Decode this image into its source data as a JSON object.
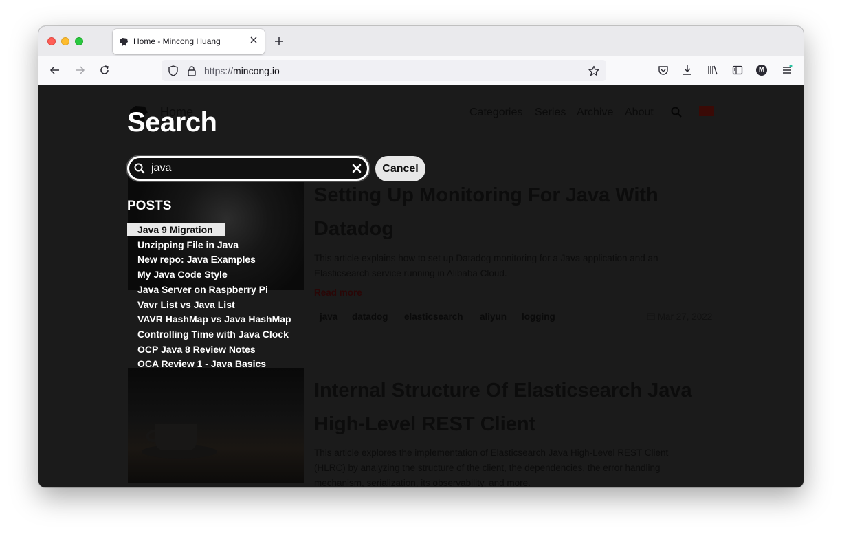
{
  "browser": {
    "tab": {
      "title": "Home - Mincong Huang"
    },
    "url": {
      "scheme": "https://",
      "host": "mincong.io"
    },
    "account_initial": "M"
  },
  "site": {
    "title": "Home",
    "nav": [
      "Categories",
      "Series",
      "Archive",
      "About"
    ]
  },
  "search": {
    "heading": "Search",
    "query": "java",
    "cancel_label": "Cancel",
    "section_heading": "POSTS",
    "selected_index": 0,
    "results": [
      "Java 9 Migration",
      "Unzipping File in Java",
      "New repo: Java Examples",
      "My Java Code Style",
      "Java Server on Raspberry Pi",
      "Vavr List vs Java List",
      "VAVR HashMap vs Java HashMap",
      "Controlling Time with Java Clock",
      "OCP Java 8 Review Notes",
      "OCA Review 1 - Java Basics"
    ]
  },
  "posts": [
    {
      "title_line1": "Setting Up Monitoring For Java With",
      "title_line2": "Datadog",
      "excerpt_line1": "This article explains how to set up Datadog monitoring for a Java application and an",
      "excerpt_line2": "Elasticsearch service running in Alibaba Cloud.",
      "read_more": "Read more",
      "tags": [
        "java",
        "datadog",
        "elasticsearch",
        "aliyun",
        "logging"
      ],
      "date": "Mar 27, 2022"
    },
    {
      "title_line1": "Internal Structure Of Elasticsearch Java",
      "title_line2": "High-Level REST Client",
      "excerpt_line1": "This article explores the implementation of Elasticsearch Java High-Level REST Client",
      "excerpt_line2": "(HLRC) by analyzing the structure of the client, the dependencies, the error handling",
      "excerpt_line3": "mechanism, serialization, its observability, and more."
    }
  ]
}
